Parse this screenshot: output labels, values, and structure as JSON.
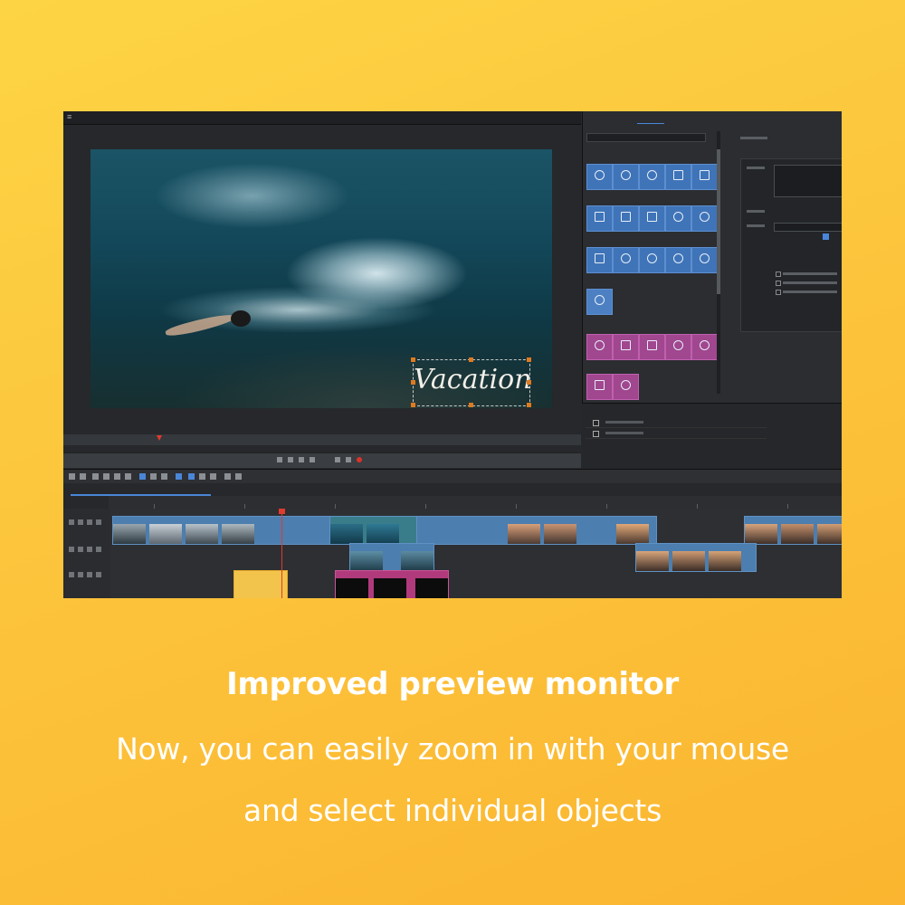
{
  "screenshot": {
    "menubar": {
      "menu_icon": "hamburger-icon"
    },
    "preview": {
      "title_text": "Vacation",
      "accent_handle_color": "#e07a1f",
      "playhead_color": "#e03b2e"
    },
    "right_panel": {
      "effects_tile_color": "#3f74b8",
      "transitions_tile_color": "#a0478f"
    },
    "timeline": {
      "selection_color": "#4a86d8"
    }
  },
  "caption": {
    "headline": "Improved preview monitor",
    "line1": "Now, you can easily zoom in with your mouse",
    "line2": "and select individual objects"
  },
  "colors": {
    "background_top": "#fdd444",
    "background_bottom": "#fbb530",
    "caption_text": "#ffffff"
  }
}
